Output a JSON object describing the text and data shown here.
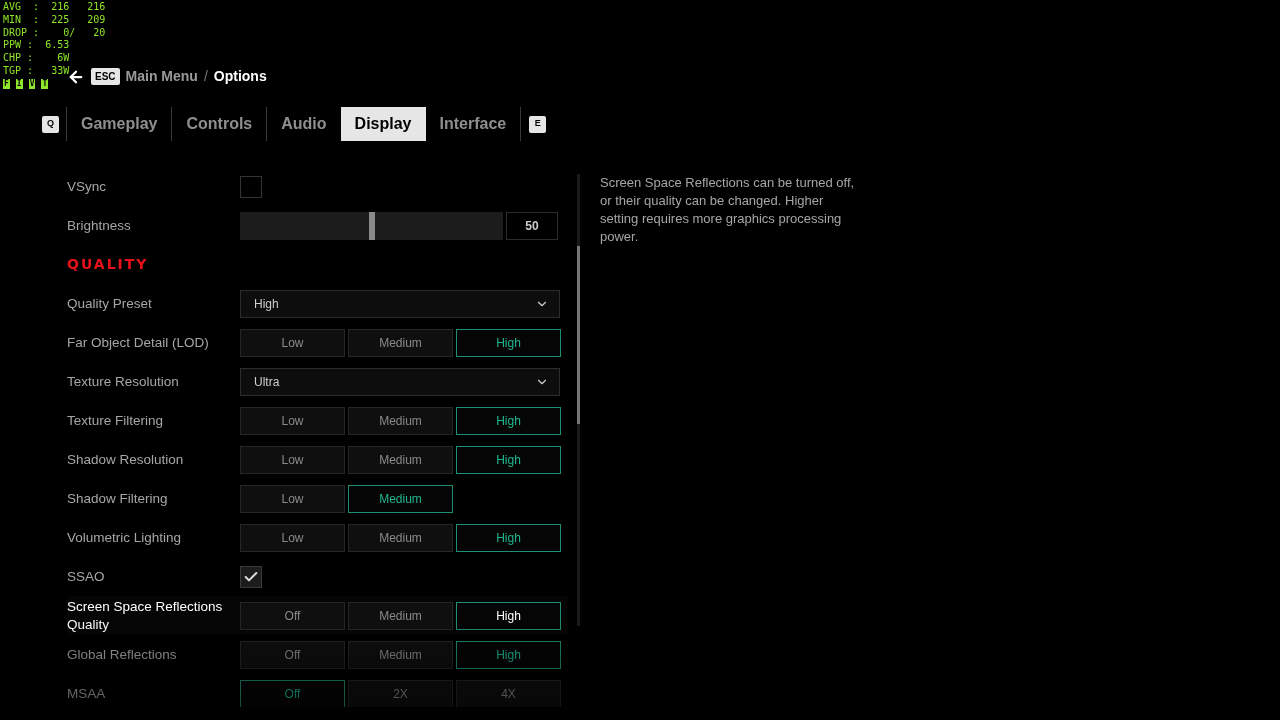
{
  "perf_overlay": {
    "lines": [
      "AVG  :  216   216",
      "MIN  :  225   209",
      "DROP :    0/   20",
      "PPW :  6.53",
      "CHP :    6W",
      "TGP :   33W"
    ],
    "flags": [
      "F",
      "I",
      "V",
      "T"
    ]
  },
  "breadcrumb": {
    "back_key": "ESC",
    "parent": "Main Menu",
    "separator": "/",
    "current": "Options"
  },
  "tabs": {
    "prev_key": "Q",
    "next_key": "E",
    "items": [
      {
        "label": "Gameplay",
        "selected": false
      },
      {
        "label": "Controls",
        "selected": false
      },
      {
        "label": "Audio",
        "selected": false
      },
      {
        "label": "Display",
        "selected": true
      },
      {
        "label": "Interface",
        "selected": false
      }
    ]
  },
  "settings": [
    {
      "kind": "checkbox",
      "label": "VSync",
      "checked": false,
      "focused": false
    },
    {
      "kind": "slider",
      "label": "Brightness",
      "level": 0.5,
      "value": "50",
      "focused": false
    },
    {
      "kind": "heading",
      "label": "QUALITY"
    },
    {
      "kind": "dropdown",
      "label": "Quality Preset",
      "value": "High",
      "focused": false
    },
    {
      "kind": "options",
      "label": "Far Object Detail (LOD)",
      "focused": false,
      "options": [
        {
          "label": "Low",
          "selected": false
        },
        {
          "label": "Medium",
          "selected": false
        },
        {
          "label": "High",
          "selected": true
        }
      ]
    },
    {
      "kind": "dropdown",
      "label": "Texture Resolution",
      "value": "Ultra",
      "focused": false
    },
    {
      "kind": "options",
      "label": "Texture Filtering",
      "focused": false,
      "options": [
        {
          "label": "Low",
          "selected": false
        },
        {
          "label": "Medium",
          "selected": false
        },
        {
          "label": "High",
          "selected": true
        }
      ]
    },
    {
      "kind": "options",
      "label": "Shadow Resolution",
      "focused": false,
      "options": [
        {
          "label": "Low",
          "selected": false
        },
        {
          "label": "Medium",
          "selected": false
        },
        {
          "label": "High",
          "selected": true
        }
      ]
    },
    {
      "kind": "options",
      "label": "Shadow Filtering",
      "focused": false,
      "options": [
        {
          "label": "Low",
          "selected": false
        },
        {
          "label": "Medium",
          "selected": true
        }
      ]
    },
    {
      "kind": "options",
      "label": "Volumetric Lighting",
      "focused": false,
      "options": [
        {
          "label": "Low",
          "selected": false
        },
        {
          "label": "Medium",
          "selected": false
        },
        {
          "label": "High",
          "selected": true
        }
      ]
    },
    {
      "kind": "checkbox",
      "label": "SSAO",
      "checked": true,
      "focused": false
    },
    {
      "kind": "options",
      "label": "Screen Space Reflections Quality",
      "focused": true,
      "options": [
        {
          "label": "Off",
          "selected": false
        },
        {
          "label": "Medium",
          "selected": false
        },
        {
          "label": "High",
          "selected": true
        }
      ]
    },
    {
      "kind": "options",
      "label": "Global Reflections",
      "focused": false,
      "options": [
        {
          "label": "Off",
          "selected": false
        },
        {
          "label": "Medium",
          "selected": false
        },
        {
          "label": "High",
          "selected": true
        }
      ]
    },
    {
      "kind": "options",
      "label": "MSAA",
      "focused": false,
      "options": [
        {
          "label": "Off",
          "selected": true
        },
        {
          "label": "2X",
          "selected": false
        },
        {
          "label": "4X",
          "selected": false
        }
      ]
    }
  ],
  "description": "Screen Space Reflections can be turned off, or their quality can be changed. Higher setting requires more graphics processing power."
}
